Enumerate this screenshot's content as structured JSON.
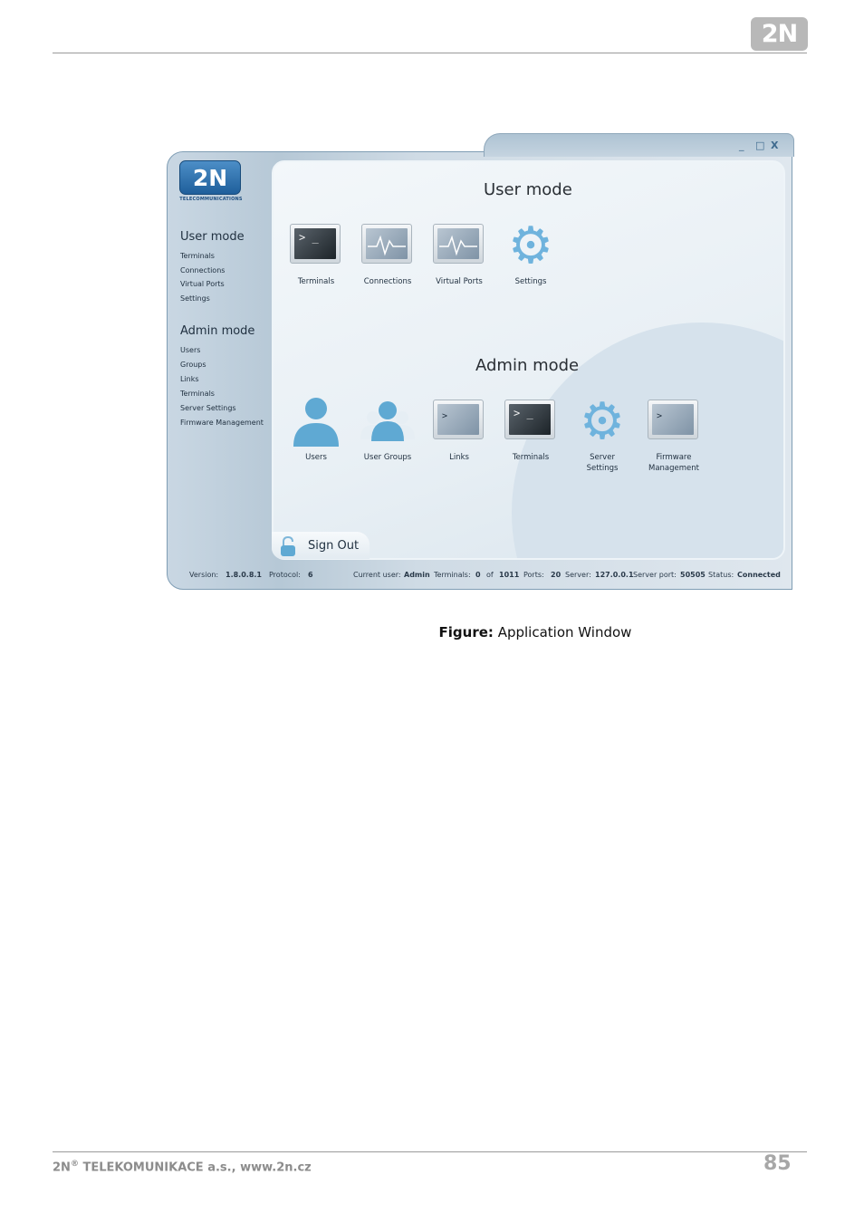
{
  "header": {
    "logo_text": "2N"
  },
  "window": {
    "controls": {
      "minimize": "_",
      "maximize": "□",
      "close": "X"
    },
    "app_logo": {
      "text": "2N",
      "subtitle": "TELECOMMUNICATIONS"
    },
    "sidebar": {
      "user_mode": {
        "title": "User mode",
        "items": [
          "Terminals",
          "Connections",
          "Virtual Ports",
          "Settings"
        ]
      },
      "admin_mode": {
        "title": "Admin mode",
        "items": [
          "Users",
          "Groups",
          "Links",
          "Terminals",
          "Server Settings",
          "Firmware Management"
        ]
      }
    },
    "main": {
      "user_mode": {
        "title": "User mode",
        "tiles": [
          "Terminals",
          "Connections",
          "Virtual Ports",
          "Settings"
        ]
      },
      "admin_mode": {
        "title": "Admin mode",
        "tiles": [
          "Users",
          "User Groups",
          "Links",
          "Terminals",
          "Server Settings",
          "Firmware Management"
        ]
      }
    },
    "sign_out": "Sign Out",
    "status_bar": {
      "version_label": "Version:",
      "version": "1.8.0.8.1",
      "protocol_label": "Protocol:",
      "protocol": "6",
      "user_label": "Current user:",
      "user": "Admin",
      "terminals_label": "Terminals:",
      "terminals": "0",
      "of_label": "of",
      "terminals_total": "1011",
      "ports_label": "Ports:",
      "ports": "20",
      "server_label": "Server:",
      "server": "127.0.0.1",
      "server_port_label": "Server port:",
      "server_port": "50505",
      "status_label": "Status:",
      "status": "Connected"
    }
  },
  "caption": {
    "label": "Figure:",
    "text": "Application Window"
  },
  "footer": {
    "company_prefix": "2N",
    "registered": "®",
    "company": "TELEKOMUNIKACE a.s., www.2n.cz",
    "page_number": "85"
  }
}
